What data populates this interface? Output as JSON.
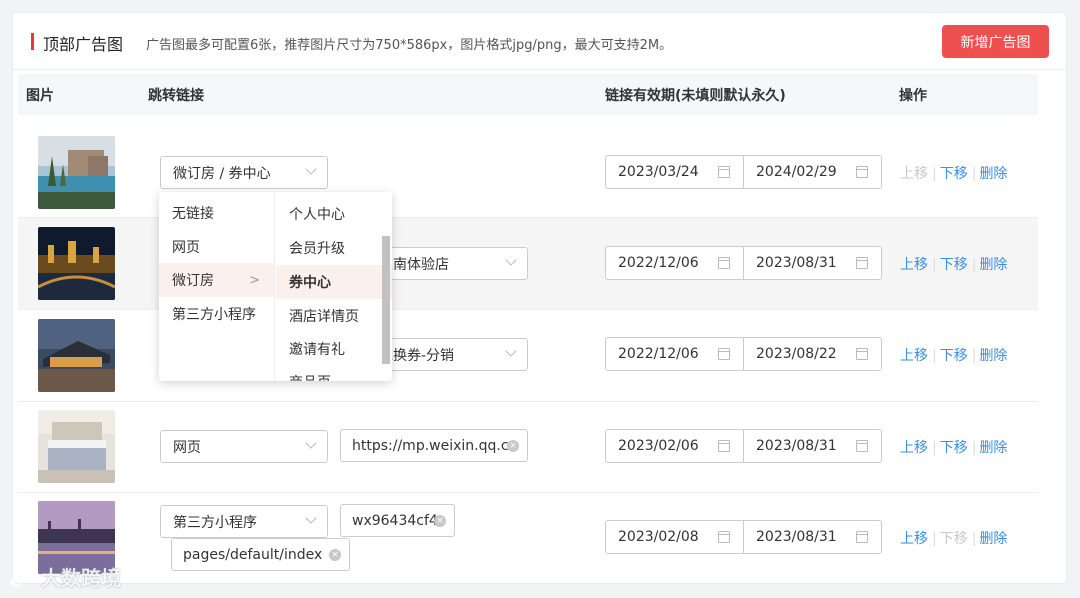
{
  "header": {
    "title": "顶部广告图",
    "tip": "广告图最多可配置6张，推荐图片尺寸为750*586px，图片格式jpg/png，最大可支持2M。",
    "add_button": "新增广告图"
  },
  "columns": [
    "图片",
    "跳转链接",
    "链接有效期(未填则默认永久)",
    "操作"
  ],
  "rows": [
    {
      "link_type": "微订房 / 券中心",
      "extra": [],
      "start": "2023/03/24",
      "end": "2024/02/29",
      "ops": [
        "上移",
        "下移",
        "删除"
      ],
      "up_enabled": false,
      "down_enabled": true
    },
    {
      "link_type": "",
      "extra": [
        "区南体验店"
      ],
      "start": "2022/12/06",
      "end": "2023/08/31",
      "ops": [
        "上移",
        "下移",
        "删除"
      ],
      "up_enabled": true,
      "down_enabled": true
    },
    {
      "link_type": "",
      "extra": [
        "兑换券-分销"
      ],
      "start": "2022/12/06",
      "end": "2023/08/22",
      "ops": [
        "上移",
        "下移",
        "删除"
      ],
      "up_enabled": true,
      "down_enabled": true
    },
    {
      "link_type": "网页",
      "extra": [
        "https://mp.weixin.qq.cc"
      ],
      "start": "2023/02/06",
      "end": "2023/08/31",
      "ops": [
        "上移",
        "下移",
        "删除"
      ],
      "up_enabled": true,
      "down_enabled": true
    },
    {
      "link_type": "第三方小程序",
      "extra": [
        "wx96434cf4",
        "pages/default/index"
      ],
      "start": "2023/02/08",
      "end": "2023/08/31",
      "ops": [
        "上移",
        "下移",
        "删除"
      ],
      "up_enabled": true,
      "down_enabled": false
    }
  ],
  "dropdown": {
    "level1": [
      "无链接",
      "网页",
      "微订房",
      "第三方小程序"
    ],
    "level1_active": "微订房",
    "level2": [
      "个人中心",
      "会员升级",
      "券中心",
      "酒店详情页",
      "邀请有礼",
      "商品页"
    ],
    "level2_active": "券中心"
  },
  "watermark": "大数跨境",
  "icons": {
    "calendar": "calendar-icon",
    "clear": "clear-icon",
    "chevron": "chevron-down-icon",
    "arrow": "chevron-right-icon"
  },
  "colors": {
    "accent_red": "#ee4f4f",
    "link_blue": "#3a8ee6",
    "disabled": "#c9c9c9"
  }
}
